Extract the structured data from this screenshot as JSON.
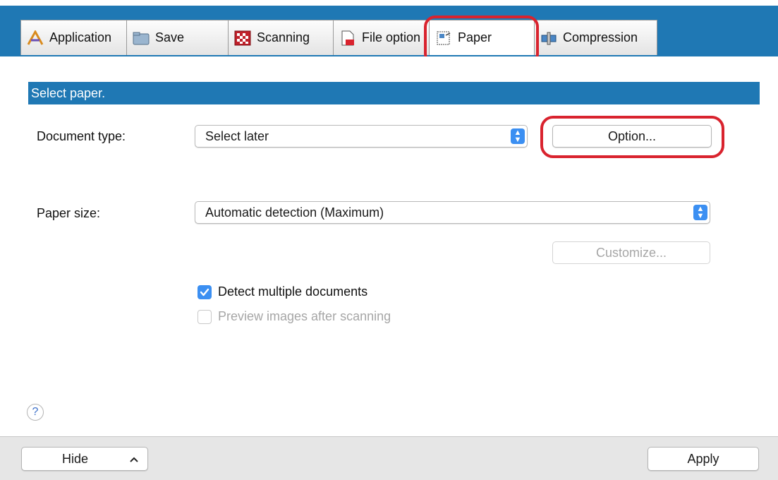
{
  "tabs": [
    {
      "label": "Application",
      "icon": "application-icon"
    },
    {
      "label": "Save",
      "icon": "folder-icon"
    },
    {
      "label": "Scanning",
      "icon": "scanning-icon"
    },
    {
      "label": "File option",
      "icon": "pdf-file-icon"
    },
    {
      "label": "Paper",
      "icon": "paper-icon"
    },
    {
      "label": "Compression",
      "icon": "compression-icon"
    }
  ],
  "active_tab": "Paper",
  "section": {
    "title": "Select paper."
  },
  "document_type": {
    "label": "Document type:",
    "value": "Select later"
  },
  "option_button": "Option...",
  "paper_size": {
    "label": "Paper size:",
    "value": "Automatic detection (Maximum)"
  },
  "customize_button": "Customize...",
  "checkboxes": [
    {
      "label": "Detect multiple documents",
      "checked": true,
      "enabled": true
    },
    {
      "label": "Preview images after scanning",
      "checked": false,
      "enabled": false
    }
  ],
  "help": "?",
  "footer": {
    "hide_label": "Hide",
    "apply_label": "Apply"
  },
  "colors": {
    "tab_bar": "#1f78b4",
    "section_header": "#1f78b4",
    "highlight": "#d9232e",
    "checkbox": "#3b8ff2"
  }
}
